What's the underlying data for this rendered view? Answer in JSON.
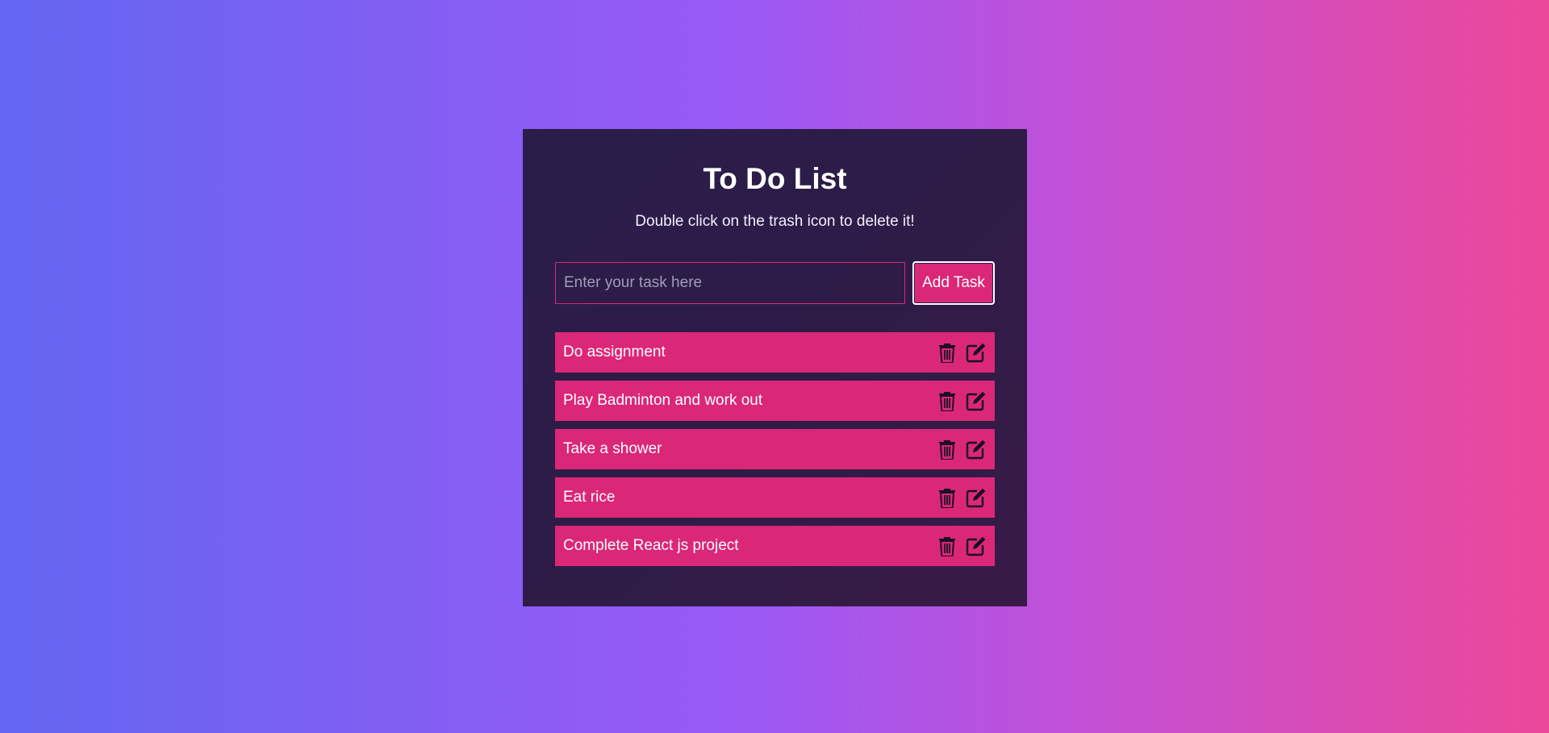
{
  "app": {
    "title": "To Do List",
    "subtitle": "Double click on the trash icon to delete it!"
  },
  "form": {
    "input_placeholder": "Enter your task here",
    "input_value": "",
    "add_button_label": "Add Task"
  },
  "tasks": [
    {
      "text": "Do assignment",
      "delete_icon": "trash-icon",
      "edit_icon": "edit-icon"
    },
    {
      "text": "Play Badminton and work out",
      "delete_icon": "trash-icon",
      "edit_icon": "edit-icon"
    },
    {
      "text": "Take a shower",
      "delete_icon": "trash-icon",
      "edit_icon": "edit-icon"
    },
    {
      "text": "Eat rice",
      "delete_icon": "trash-icon",
      "edit_icon": "edit-icon"
    },
    {
      "text": "Complete React js project",
      "delete_icon": "trash-icon",
      "edit_icon": "edit-icon"
    }
  ],
  "colors": {
    "background_start": "#6366f1",
    "background_mid": "#a855f7",
    "background_end": "#ec4899",
    "card": "#2c1c48",
    "accent": "#db2777",
    "icon": "#1a0f24"
  }
}
